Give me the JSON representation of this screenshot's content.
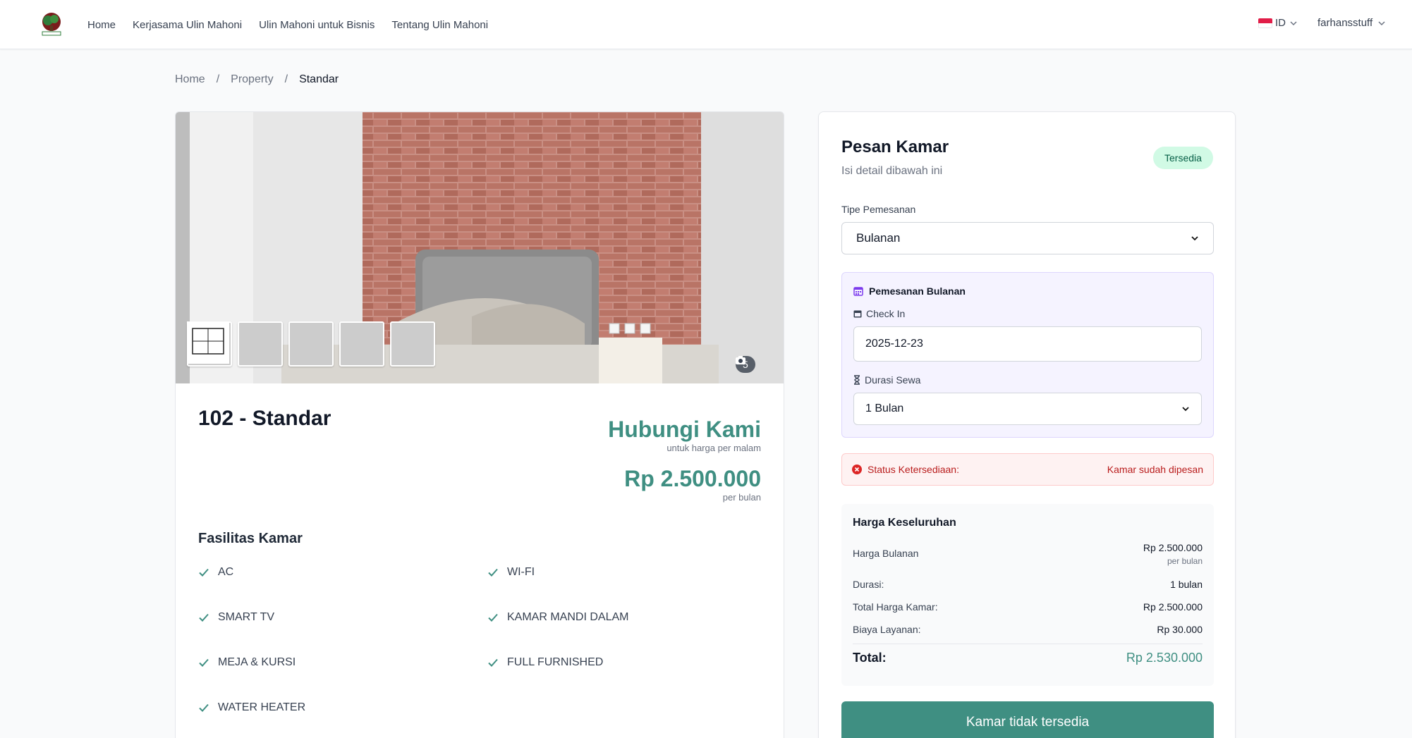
{
  "colors": {
    "accent": "#3f8f82",
    "available_bg": "#d1fae5",
    "error": "#b91c1c"
  },
  "nav": {
    "links": [
      "Home",
      "Kerjasama Ulin Mahoni",
      "Ulin Mahoni untuk Bisnis",
      "Tentang Ulin Mahoni"
    ],
    "lang": "ID",
    "user": "farhansstuff"
  },
  "breadcrumb": {
    "home": "Home",
    "sep": "/",
    "property": "Property",
    "current": "Standar"
  },
  "gallery": {
    "count": "5",
    "thumb_count": 5
  },
  "room": {
    "title": "102 - Standar",
    "contact_label": "Hubungi Kami",
    "nightly_note": "untuk harga per malam",
    "monthly_price": "Rp 2.500.000",
    "monthly_note": "per bulan"
  },
  "facilities": {
    "title": "Fasilitas Kamar",
    "items": [
      "AC",
      "WI-FI",
      "SMART TV",
      "KAMAR MANDI DALAM",
      "MEJA & KURSI",
      "FULL FURNISHED",
      "WATER HEATER"
    ]
  },
  "booking": {
    "title": "Pesan Kamar",
    "subtitle": "Isi detail dibawah ini",
    "badge": "Tersedia",
    "type_label": "Tipe Pemesanan",
    "type_value": "Bulanan",
    "monthly_header": "Pemesanan Bulanan",
    "checkin_label": "Check In",
    "checkin_value": "2025-12-23",
    "duration_label": "Durasi Sewa",
    "duration_value": "1 Bulan",
    "status_label": "Status Ketersediaan:",
    "status_value": "Kamar sudah dipesan"
  },
  "summary": {
    "title": "Harga Keseluruhan",
    "monthly_label": "Harga Bulanan",
    "monthly_value": "Rp 2.500.000",
    "monthly_note": "per bulan",
    "duration_label": "Durasi:",
    "duration_value": "1 bulan",
    "room_total_label": "Total Harga Kamar:",
    "room_total_value": "Rp 2.500.000",
    "service_label": "Biaya Layanan:",
    "service_value": "Rp 30.000",
    "total_label": "Total:",
    "total_value": "Rp 2.530.000"
  },
  "cta": {
    "label": "Kamar tidak tersedia"
  }
}
